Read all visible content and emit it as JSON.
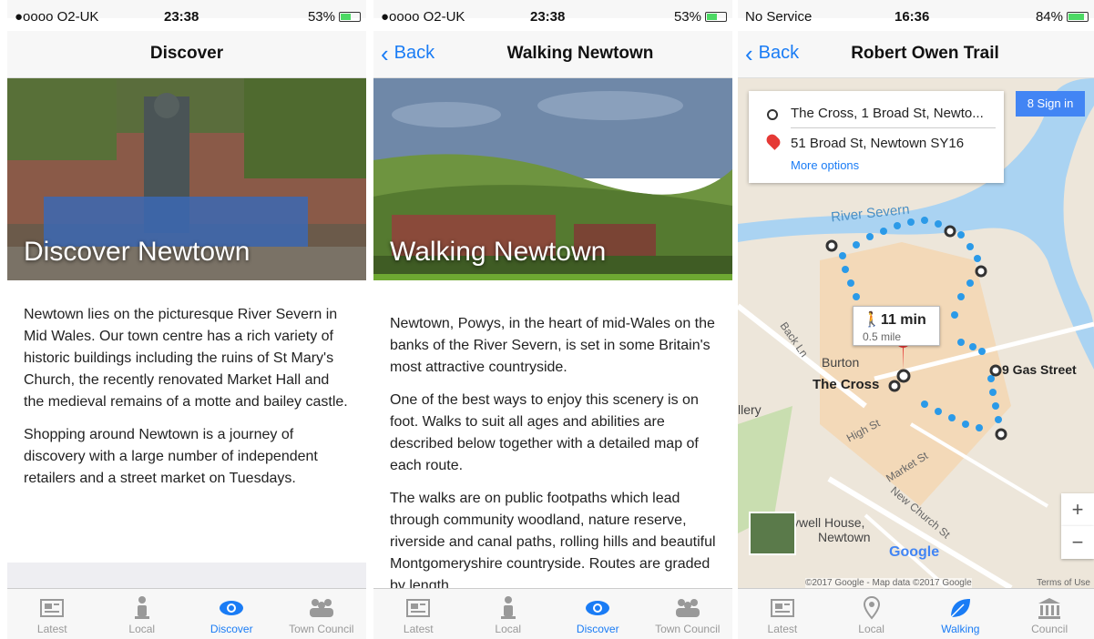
{
  "screen1": {
    "status": {
      "carrier": "●oooo O2-UK",
      "time": "23:38",
      "battery": "53%",
      "battery_level": 0.53
    },
    "nav_title": "Discover",
    "hero_caption": "Discover Newtown",
    "paragraphs": [
      "Newtown lies on the picturesque River Severn in Mid Wales. Our town centre has a rich variety of historic buildings including the ruins of St Mary's Church, the recently renovated Market Hall and the medieval remains of a motte and bailey castle.",
      "Shopping around Newtown is a journey of discovery with a large number of independent retailers and a street market on Tuesdays."
    ],
    "tabs": [
      {
        "label": "Latest",
        "icon": "newspaper-icon"
      },
      {
        "label": "Local",
        "icon": "person-icon"
      },
      {
        "label": "Discover",
        "icon": "eye-icon"
      },
      {
        "label": "Town Council",
        "icon": "group-icon"
      }
    ],
    "active_tab": "Discover"
  },
  "screen2": {
    "status": {
      "carrier": "●oooo O2-UK",
      "time": "23:38",
      "battery": "53%",
      "battery_level": 0.53
    },
    "back_label": "Back",
    "nav_title": "Walking Newtown",
    "hero_caption": "Walking Newtown",
    "paragraphs": [
      "Newtown, Powys, in the heart of mid-Wales on the banks of the River Severn, is set in some Britain's most attractive countryside.",
      "One of the best ways to enjoy this scenery is on foot. Walks to suit all ages and abilities are described below together with a detailed map of each route.",
      "The walks are on public footpaths which lead through community woodland, nature reserve, riverside and canal paths, rolling hills and beautiful Montgomeryshire countryside. Routes are graded by length"
    ],
    "tabs": [
      {
        "label": "Latest",
        "icon": "newspaper-icon"
      },
      {
        "label": "Local",
        "icon": "person-icon"
      },
      {
        "label": "Discover",
        "icon": "eye-icon"
      },
      {
        "label": "Town Council",
        "icon": "group-icon"
      }
    ],
    "active_tab": "Discover"
  },
  "screen3": {
    "status": {
      "carrier": "No Service",
      "time": "16:36",
      "battery": "84%",
      "battery_level": 0.84
    },
    "back_label": "Back",
    "nav_title": "Robert Owen Trail",
    "directions": {
      "from": "The Cross, 1 Broad St, Newto...",
      "to": "51 Broad St, Newtown SY16",
      "more": "More options"
    },
    "sign_in": "Sign in",
    "duration": "11 min",
    "distance": "0.5 mile",
    "map_labels": {
      "river": "River Severn",
      "gas_street": "9 Gas Street",
      "the_cross": "The Cross",
      "burton": "Burton",
      "gallery": "llery",
      "high_st": "High St",
      "market_st": "Market St",
      "back_ln": "Back Ln",
      "new_church": "New Church St",
      "ywell_house": "ywell House,",
      "newtown": "Newtown",
      "google": "Google",
      "copyright": "©2017 Google - Map data ©2017 Google",
      "terms": "Terms of Use"
    },
    "tabs": [
      {
        "label": "Latest",
        "icon": "newspaper-icon"
      },
      {
        "label": "Local",
        "icon": "pin-icon"
      },
      {
        "label": "Walking",
        "icon": "leaf-icon"
      },
      {
        "label": "Council",
        "icon": "building-icon"
      }
    ],
    "active_tab": "Walking"
  },
  "colors": {
    "accent": "#1a7cf5",
    "route": "#2b9ae8",
    "river": "#aad3f2"
  }
}
